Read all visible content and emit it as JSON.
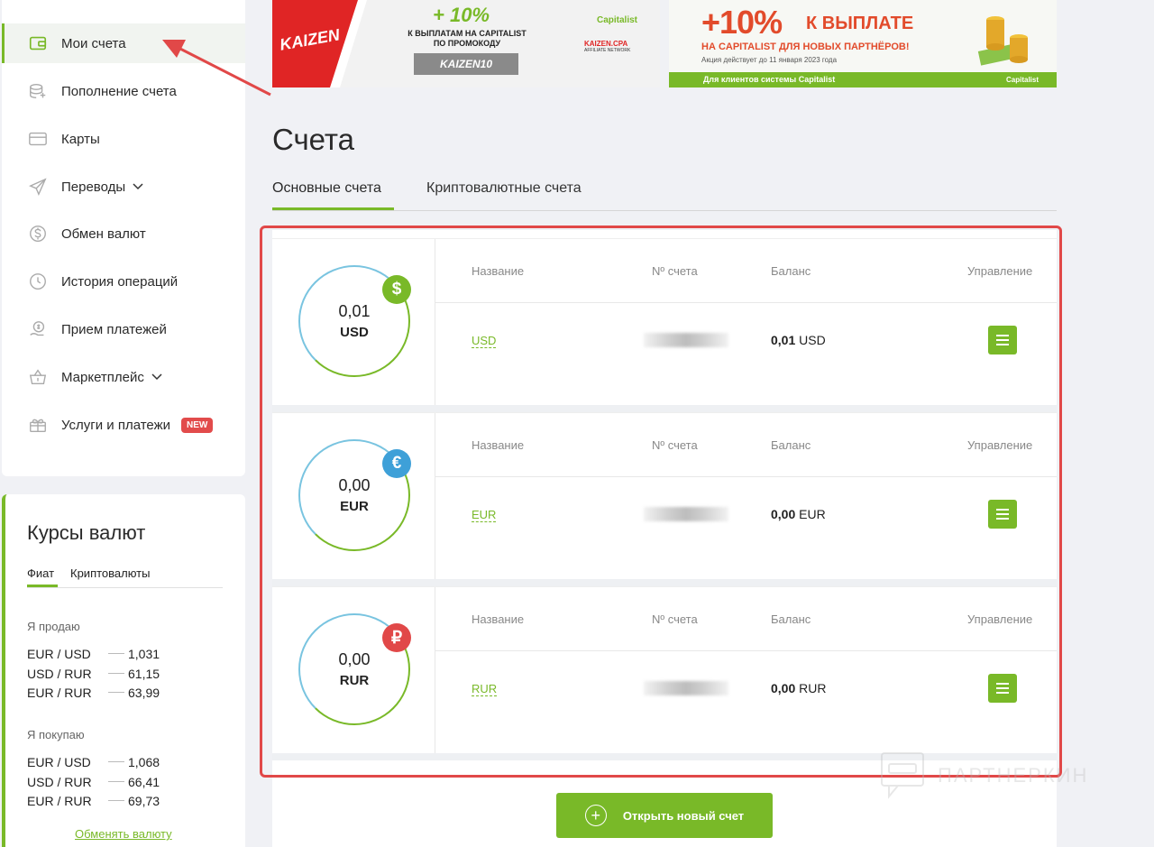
{
  "sidebar": {
    "items": [
      {
        "label": "Мои счета",
        "icon": "wallet-icon"
      },
      {
        "label": "Пополнение счета",
        "icon": "coins-icon"
      },
      {
        "label": "Карты",
        "icon": "card-icon"
      },
      {
        "label": "Переводы",
        "icon": "paper-plane-icon"
      },
      {
        "label": "Обмен валют",
        "icon": "dollar-circle-icon"
      },
      {
        "label": "История операций",
        "icon": "clock-icon"
      },
      {
        "label": "Прием платежей",
        "icon": "hand-coin-icon"
      },
      {
        "label": "Маркетплейс",
        "icon": "basket-icon"
      },
      {
        "label": "Услуги и платежи",
        "icon": "gift-icon"
      }
    ],
    "new_badge": "NEW"
  },
  "rates": {
    "title": "Курсы валют",
    "tab_fiat": "Фиат",
    "tab_crypto": "Криптовалюты",
    "sell_label": "Я продаю",
    "sell": [
      {
        "pair": "EUR / USD",
        "value": "1,031"
      },
      {
        "pair": "USD / RUR",
        "value": "61,15"
      },
      {
        "pair": "EUR / RUR",
        "value": "63,99"
      }
    ],
    "buy_label": "Я покупаю",
    "buy": [
      {
        "pair": "EUR / USD",
        "value": "1,068"
      },
      {
        "pair": "USD / RUR",
        "value": "66,41"
      },
      {
        "pair": "EUR / RUR",
        "value": "69,73"
      }
    ],
    "exchange_link": "Обменять валюту"
  },
  "banner1": {
    "logo": "KAIZEN",
    "headline": "+ 10%",
    "line1": "К ВЫПЛАТАМ НА CAPITALIST",
    "line2": "ПО ПРОМОКОДУ",
    "code": "KAIZEN10",
    "brand": "Capitalist",
    "partner": "KAIZEN.CPA",
    "partner_sub": "AFFILIATE NETWORK"
  },
  "banner2": {
    "headline_big": "+10%",
    "headline_rest": "К ВЫПЛАТЕ",
    "sub": "НА CAPITALIST ДЛЯ НОВЫХ ПАРТНЁРОВ!",
    "note": "Акция действует до 11 января 2023 года",
    "footer": "Для клиентов системы Capitalist",
    "footer_brand": "Capitalist"
  },
  "main": {
    "title": "Счета",
    "tabs": [
      "Основные счета",
      "Криптовалютные счета"
    ]
  },
  "columns": {
    "name": "Название",
    "number": "Nº счета",
    "balance": "Баланс",
    "manage": "Управление"
  },
  "accounts": [
    {
      "amount": "0,01",
      "currency": "USD",
      "symbol": "$",
      "color": "#79b928",
      "name": "USD",
      "balance_value": "0,01",
      "balance_currency": "USD"
    },
    {
      "amount": "0,00",
      "currency": "EUR",
      "symbol": "€",
      "color": "#3ea0d8",
      "name": "EUR",
      "balance_value": "0,00",
      "balance_currency": "EUR"
    },
    {
      "amount": "0,00",
      "currency": "RUR",
      "symbol": "₽",
      "color": "#e14848",
      "name": "RUR",
      "balance_value": "0,00",
      "balance_currency": "RUR"
    }
  ],
  "open_button": "Открыть новый счет",
  "watermark": "ПАРТНЕРКИН",
  "colors": {
    "accent": "#79b928",
    "highlight": "#e14848"
  }
}
